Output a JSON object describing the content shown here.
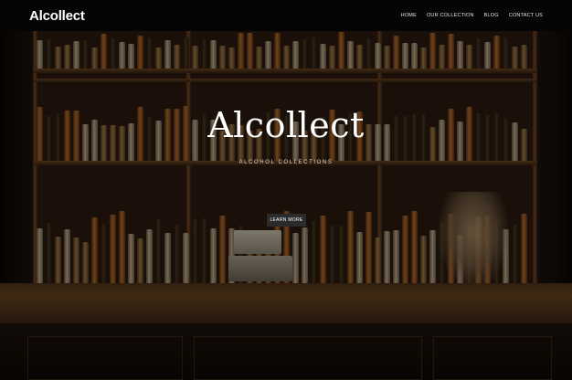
{
  "header": {
    "brand": "Alcollect",
    "nav": [
      {
        "label": "HOME"
      },
      {
        "label": "OUR COLLECTION"
      },
      {
        "label": "BLOG"
      },
      {
        "label": "CONTACT US"
      }
    ]
  },
  "hero": {
    "title": "Alcollect",
    "subtitle": "ALCOHOL COLLECTIONS",
    "cta_label": "LEARN MORE"
  },
  "colors": {
    "topbar_bg": "#050505",
    "cta_bg": "#2b2b2b",
    "text": "#ffffff"
  }
}
